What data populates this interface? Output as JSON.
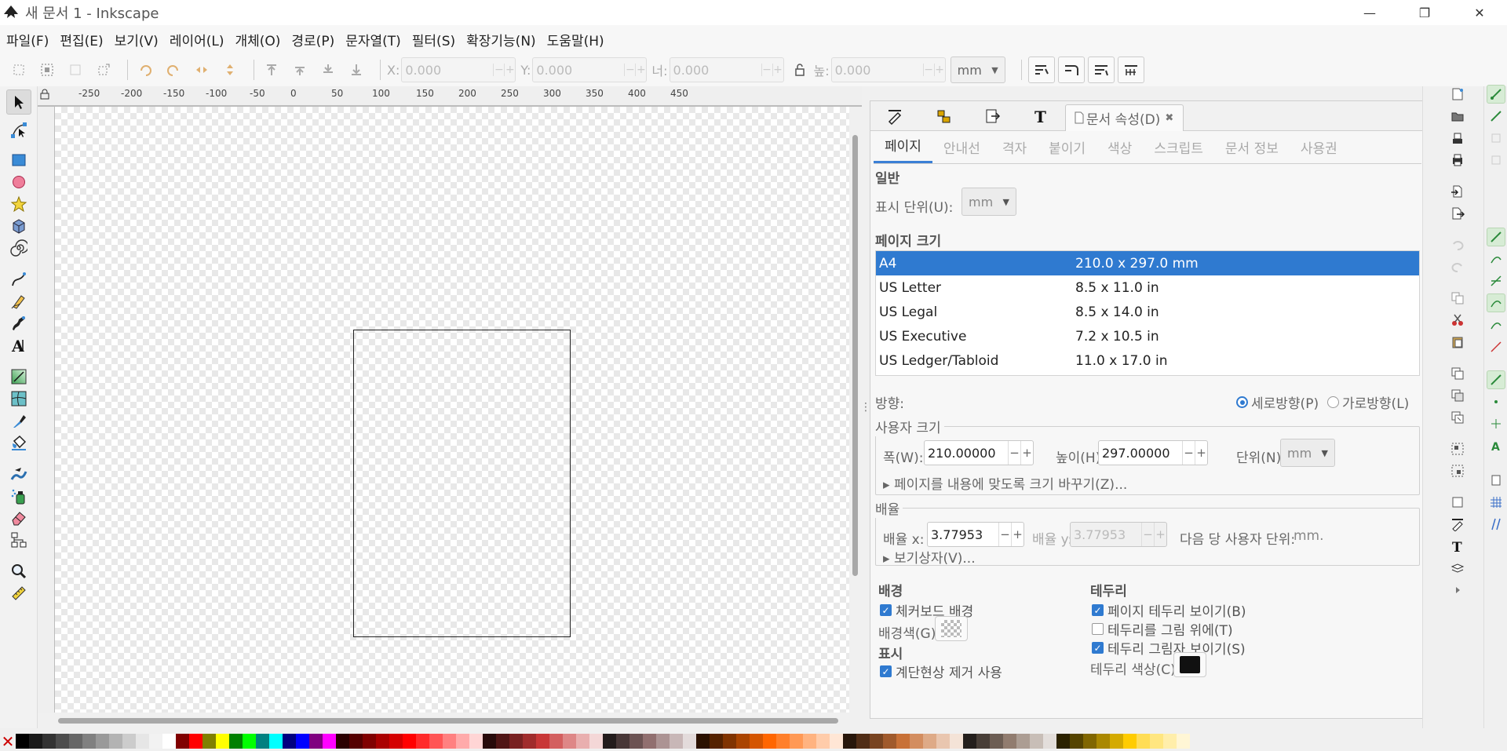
{
  "window": {
    "title": "새 문서 1 - Inkscape",
    "controls": {
      "minimize": "—",
      "restore": "❐",
      "close": "✕"
    }
  },
  "menu": [
    "파일(F)",
    "편집(E)",
    "보기(V)",
    "레이어(L)",
    "개체(O)",
    "경로(P)",
    "문자열(T)",
    "필터(S)",
    "확장기능(N)",
    "도움말(H)"
  ],
  "toolbar": {
    "x_label": "X:",
    "x_value": "0.000",
    "y_label": "Y:",
    "y_value": "0.000",
    "w_label": "너:",
    "w_value": "0.000",
    "h_label": "높:",
    "h_value": "0.000",
    "unit": "mm"
  },
  "ruler": {
    "top": [
      "-250",
      "-200",
      "-150",
      "-100",
      "-50",
      "0",
      "50",
      "100",
      "150",
      "200",
      "250",
      "300",
      "350",
      "400",
      "450"
    ]
  },
  "dialog": {
    "active_tab": "문서 속성(D)",
    "subtabs": [
      "페이지",
      "안내선",
      "격자",
      "붙이기",
      "색상",
      "스크립트",
      "문서 정보",
      "사용권"
    ],
    "general_title": "일반",
    "display_units_label": "표시 단위(U):",
    "display_units_value": "mm",
    "page_size_title": "페이지 크기",
    "page_sizes": [
      {
        "name": "A4",
        "size": "210.0 x 297.0 mm"
      },
      {
        "name": "US Letter",
        "size": "8.5 x 11.0 in"
      },
      {
        "name": "US Legal",
        "size": "8.5 x 14.0 in"
      },
      {
        "name": "US Executive",
        "size": "7.2 x 10.5 in"
      },
      {
        "name": "US Ledger/Tabloid",
        "size": "11.0 x 17.0 in"
      }
    ],
    "orientation_label": "방향:",
    "portrait_label": "세로방향(P)",
    "landscape_label": "가로방향(L)",
    "custom_size_title": "사용자 크기",
    "width_label": "폭(W):",
    "width_value": "210.00000",
    "height_label": "높이(H):",
    "height_value": "297.00000",
    "units_label": "단위(N):",
    "units_value": "mm",
    "resize_expander": "페이지를 내용에 맞도록 크기 바꾸기(Z)...",
    "scale_title": "배율",
    "scale_x_label": "배율 x:",
    "scale_x_value": "3.77953",
    "scale_y_label": "배율 y:",
    "scale_y_value": "3.77953",
    "user_units_label": "다음 당 사용자 단위:",
    "user_units_value": "mm.",
    "viewbox_expander": "보기상자(V)...",
    "background_title": "배경",
    "checkerboard_label": "체커보드 배경",
    "bgcolor_label": "배경색(G):",
    "display_title": "표시",
    "antialias_label": "계단현상 제거 사용",
    "border_title": "테두리",
    "show_border_label": "페이지 테두리 보이기(B)",
    "border_on_top_label": "테두리를 그림 위에(T)",
    "border_shadow_label": "테두리 그림자 보이기(S)",
    "border_color_label": "테두리 색상(C):"
  },
  "palette": [
    "#000000",
    "#1a1a1a",
    "#333333",
    "#4d4d4d",
    "#666666",
    "#808080",
    "#999999",
    "#b3b3b3",
    "#cccccc",
    "#e6e6e6",
    "#f2f2f2",
    "#ffffff",
    "#800000",
    "#ff0000",
    "#808000",
    "#ffff00",
    "#008000",
    "#00ff00",
    "#008080",
    "#00ffff",
    "#000080",
    "#0000ff",
    "#800080",
    "#ff00ff",
    "#2b0000",
    "#550000",
    "#800000",
    "#aa0000",
    "#d40000",
    "#ff0000",
    "#ff2a2a",
    "#ff5555",
    "#ff8080",
    "#ffaaaa",
    "#ffd5d5",
    "#280b0b",
    "#501616",
    "#782121",
    "#a02c2c",
    "#c83737",
    "#d35f5f",
    "#de8787",
    "#e9afaf",
    "#f4d7d7",
    "#241c1c",
    "#483737",
    "#6c5353",
    "#916f6f",
    "#ac9393",
    "#c8b7b7",
    "#e3dbdb",
    "#2b1100",
    "#552200",
    "#803300",
    "#aa4400",
    "#d45500",
    "#ff6600",
    "#ff7f2a",
    "#ff9955",
    "#ffb380",
    "#ffccaa",
    "#ffe6d5",
    "#28170b",
    "#502d16",
    "#784421",
    "#a05a2c",
    "#c87137",
    "#d38d5f",
    "#deaa87",
    "#e9c6af",
    "#f4e3d7",
    "#241f1c",
    "#483e37",
    "#6c5d53",
    "#917c6f",
    "#ac9d93",
    "#c8beb7",
    "#e3dedb",
    "#2b2200",
    "#554400",
    "#806600",
    "#aa8800",
    "#d4aa00",
    "#ffcc00",
    "#ffdd55",
    "#ffe680",
    "#ffeeaa",
    "#fff6d5"
  ]
}
